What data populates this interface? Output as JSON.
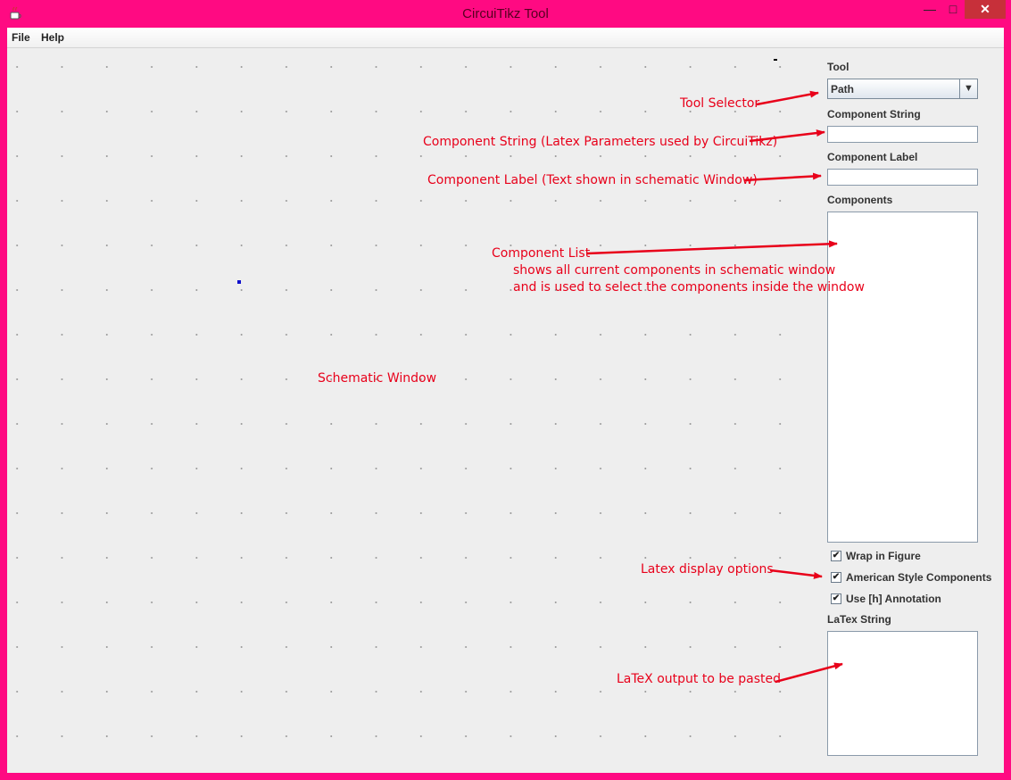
{
  "window": {
    "title": "CircuiTikz Tool",
    "min_glyph": "—",
    "max_glyph": "□",
    "close_glyph": "✕"
  },
  "menu": {
    "items": [
      "File",
      "Help"
    ]
  },
  "panel": {
    "tool_label": "Tool",
    "tool_value": "Path",
    "component_string_label": "Component String",
    "component_string_value": "",
    "component_label_label": "Component Label",
    "component_label_value": "",
    "components_label": "Components",
    "options": [
      {
        "label": "Wrap in Figure",
        "checked": true
      },
      {
        "label": "American Style Components",
        "checked": true
      },
      {
        "label": "Use [h] Annotation",
        "checked": true
      }
    ],
    "latex_label": "LaTex String",
    "latex_value": ""
  },
  "annotations": {
    "tool_selector": "Tool Selector",
    "component_string": "Component String (Latex Parameters used by CircuiTikz)",
    "component_label": "Component Label (Text shown in schematic Window)",
    "component_list": "Component List",
    "component_list_line2": "shows all current components in schematic window",
    "component_list_line3": "and is used to select the components inside the window",
    "schematic_window": "Schematic Window",
    "latex_display_options": "Latex display options",
    "latex_output": "LaTeX output to be pasted"
  },
  "colors": {
    "frame": "#ff0a82",
    "annotation": "#e8001a",
    "close_button": "#c7303a"
  }
}
